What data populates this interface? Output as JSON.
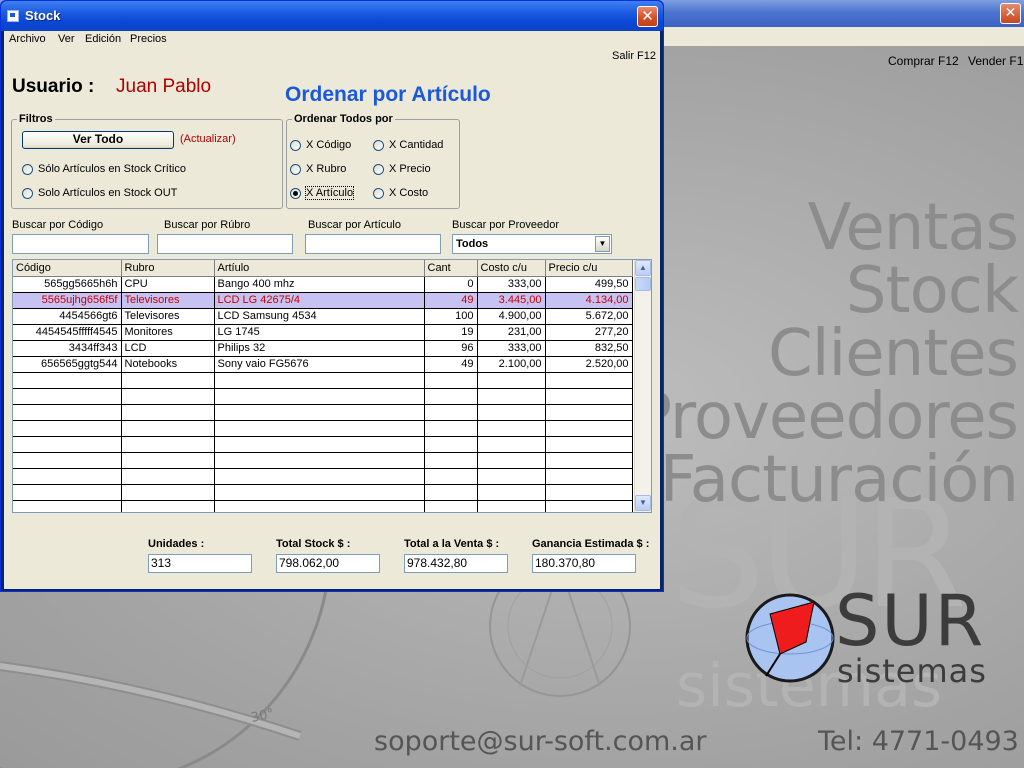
{
  "background_app": {
    "close_glyph": "✕",
    "top_links": [
      "Comprar F12",
      "Vender F1"
    ],
    "big_words": [
      "Ventas",
      "Stock",
      "Clientes",
      "Proveedores",
      "Facturación"
    ],
    "logo": {
      "sur": "SUR",
      "sistemas": "sistemas"
    },
    "watermark_mark": "30°",
    "email": "soporte@sur-soft.com.ar",
    "phone": "Tel: 4771-0493"
  },
  "window": {
    "title": "Stock",
    "close_glyph": "✕",
    "menu": [
      "Archivo",
      "Ver",
      "Edición",
      "Precios"
    ],
    "salir": "Salir F12",
    "usuario_label": "Usuario :",
    "usuario_name": "Juan Pablo",
    "order_title": "Ordenar por Artículo"
  },
  "filtros": {
    "legend": "Filtros",
    "ver_todo": "Ver Todo",
    "actualizar": "(Actualizar)",
    "options": [
      "Sólo Artículos en Stock Crítico",
      "Solo Artículos en Stock OUT"
    ]
  },
  "ordenar": {
    "legend": "Ordenar Todos por",
    "options": [
      "X Código",
      "X Cantidad",
      "X Rubro",
      "X Precio",
      "X Artículo",
      "X Costo"
    ],
    "selected": "X Artículo"
  },
  "search": {
    "codigo_label": "Buscar por Código",
    "rubro_label": "Buscar por Rúbro",
    "articulo_label": "Buscar por Artículo",
    "proveedor_label": "Buscar por Proveedor",
    "proveedor_value": "Todos",
    "dropdown_glyph": "▼"
  },
  "grid": {
    "columns": [
      "Código",
      "Rubro",
      "Artíulo",
      "Cant",
      "Costo c/u",
      "Precio c/u"
    ],
    "rows": [
      [
        "565gg5665h6h",
        "CPU",
        "Bango 400 mhz",
        "0",
        "333,00",
        "499,50"
      ],
      [
        "5565ujhg656f5f",
        "Televisores",
        "LCD LG 42675/4",
        "49",
        "3.445,00",
        "4.134,00"
      ],
      [
        "4454566gt6",
        "Televisores",
        "LCD Samsung  4534",
        "100",
        "4.900,00",
        "5.672,00"
      ],
      [
        "4454545fffff4545",
        "Monitores",
        "LG 1745",
        "19",
        "231,00",
        "277,20"
      ],
      [
        "3434ff343",
        "LCD",
        "Philips 32",
        "96",
        "333,00",
        "832,50"
      ],
      [
        "656565ggtg544",
        "Notebooks",
        "Sony vaio  FG5676",
        "49",
        "2.100,00",
        "2.520,00"
      ]
    ],
    "selected_row": 1,
    "scroll_up": "▲",
    "scroll_down": "▼"
  },
  "totals": {
    "unidades_label": "Unidades :",
    "unidades": "313",
    "stock_label": "Total Stock $ :",
    "stock": "798.062,00",
    "venta_label": "Total a la Venta  $ :",
    "venta": "978.432,80",
    "ganancia_label": "Ganancia Estimada $ :",
    "ganancia": "180.370,80"
  },
  "colors": {
    "title_blue": "#1a5ad8",
    "user_red": "#b00000",
    "selected_row_bg": "#c6c2f2",
    "selected_row_text": "#cc0000"
  }
}
